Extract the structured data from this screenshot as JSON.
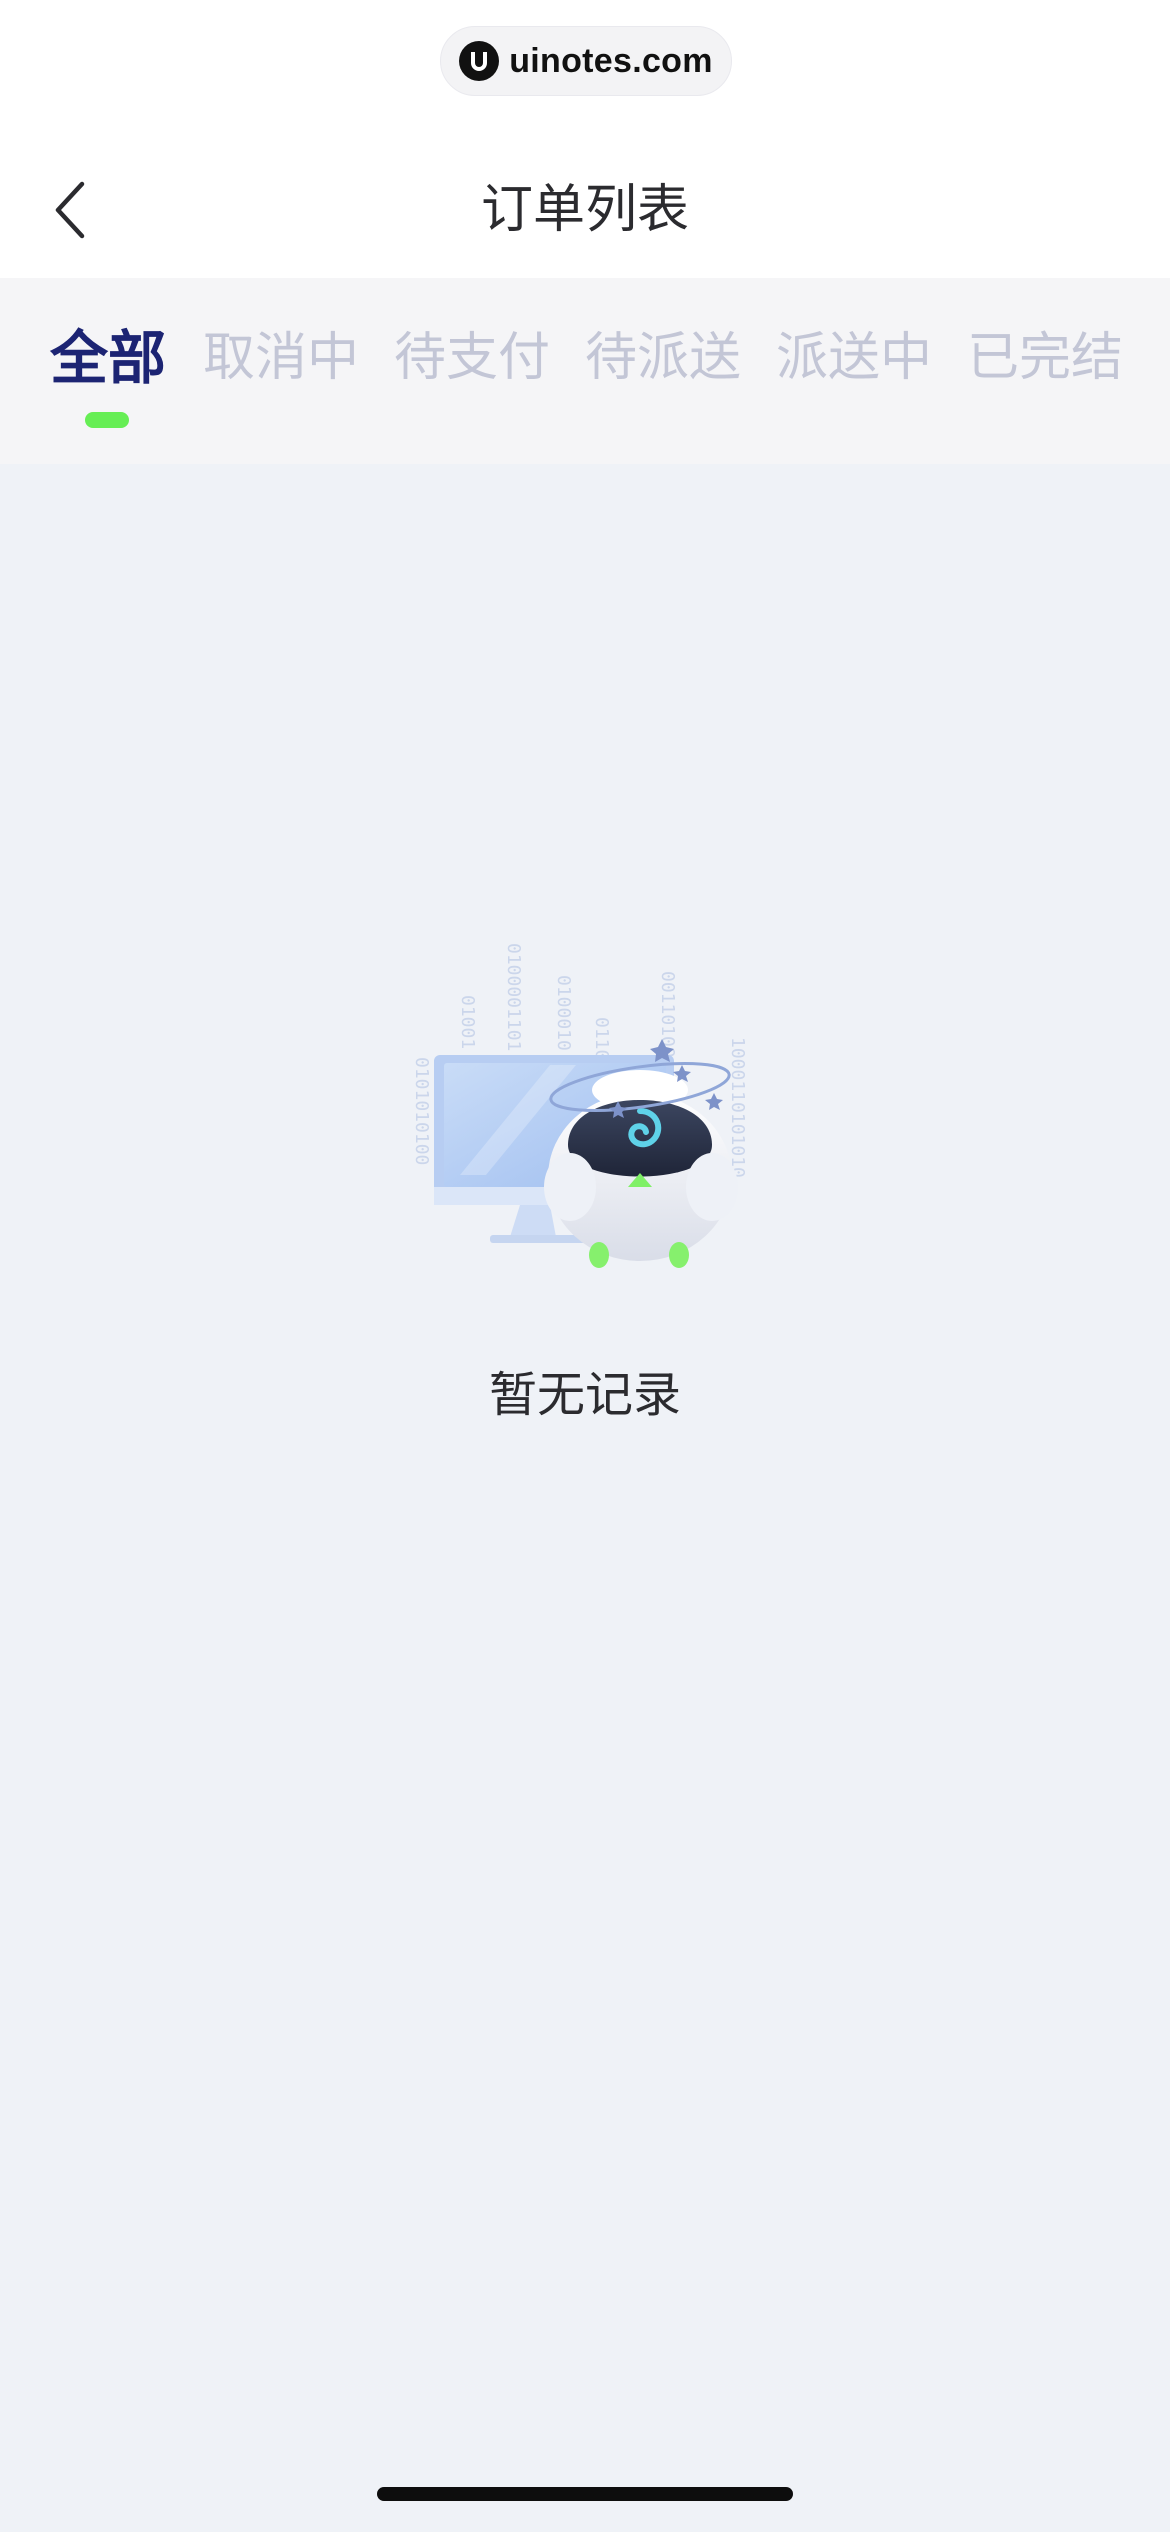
{
  "watermark": {
    "text": "uinotes.com"
  },
  "header": {
    "title": "订单列表",
    "back_icon": "chevron-left-icon"
  },
  "tabs": [
    {
      "label": "全部",
      "active": true
    },
    {
      "label": "取消中",
      "active": false
    },
    {
      "label": "待支付",
      "active": false
    },
    {
      "label": "待派送",
      "active": false
    },
    {
      "label": "派送中",
      "active": false
    },
    {
      "label": "已完结",
      "active": false
    }
  ],
  "empty_state": {
    "text": "暂无记录",
    "illustration": "confused-robot-with-monitor"
  },
  "colors": {
    "background": "#eff2f7",
    "tab_active": "#1c2473",
    "tab_inactive": "#c3c6d6",
    "tab_indicator": "#66ee55",
    "title": "#2b2b2f"
  }
}
